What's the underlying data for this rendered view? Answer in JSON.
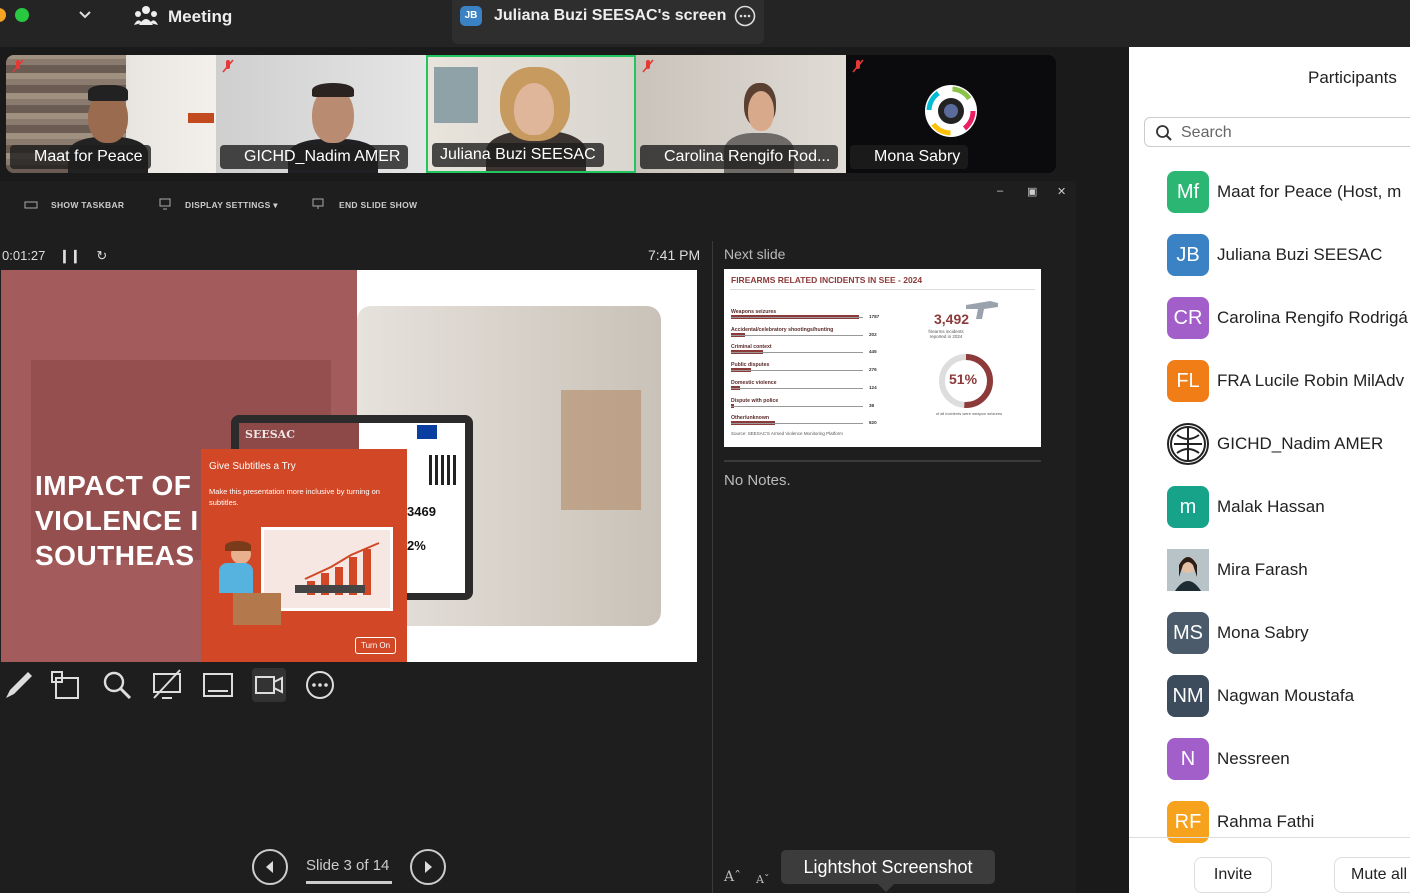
{
  "topbar": {
    "meeting_label": "Meeting",
    "share_badge": "JB",
    "share_title": "Juliana Buzi SEESAC's screen"
  },
  "tiles": [
    {
      "name": "Maat for Peace"
    },
    {
      "name": "GICHD_Nadim AMER"
    },
    {
      "name": "Juliana Buzi SEESAC"
    },
    {
      "name": "Carolina Rengifo Rod..."
    },
    {
      "name": "Mona Sabry"
    }
  ],
  "presenter": {
    "show_taskbar": "SHOW TASKBAR",
    "display_settings": "DISPLAY SETTINGS ▾",
    "end_slide_show": "END SLIDE SHOW",
    "timer": "0:01:27",
    "clock": "7:41 PM",
    "next_slide_label": "Next slide",
    "notes": "No Notes.",
    "slide_counter": "Slide 3 of 14"
  },
  "slide": {
    "title_lines": [
      "IMPACT OF",
      "VIOLENCE I",
      "SOUTHEAS"
    ],
    "laptop_logo": "SEESAC",
    "stat_number": "3469",
    "stat_percent": "2%",
    "popup_title": "Give Subtitles a Try",
    "popup_text": "Make this presentation more inclusive by turning on subtitles.",
    "popup_button": "Turn On"
  },
  "next_slide": {
    "title": "FIREARMS RELATED INCIDENTS IN SEE - 2024",
    "rows": [
      {
        "label": "Weapons seizures",
        "value": "1787"
      },
      {
        "label": "Accidental/celebratory shootings/hunting",
        "value": "202"
      },
      {
        "label": "Criminal context",
        "value": "445"
      },
      {
        "label": "Public disputes",
        "value": "276"
      },
      {
        "label": "Domestic violence",
        "value": "124"
      },
      {
        "label": "Dispute with police",
        "value": "38"
      },
      {
        "label": "Other/unknown",
        "value": "620"
      }
    ],
    "total": "3,492",
    "total_caption": "firearms incidents reported in 2024",
    "percent": "51%",
    "percent_caption": "of all incidents were weapon seizures",
    "source": "Source: SEESAC'S Armed Violence Monitoring Platform"
  },
  "lightshot": "Lightshot Screenshot",
  "participants": {
    "title": "Participants",
    "search_placeholder": "Search",
    "list": [
      {
        "initials": "Mf",
        "name": "Maat for Peace (Host, m",
        "color": "#2bb673"
      },
      {
        "initials": "JB",
        "name": "Juliana Buzi SEESAC",
        "color": "#3b82c4"
      },
      {
        "initials": "CR",
        "name": "Carolina Rengifo Rodrigá",
        "color": "#a25fc9"
      },
      {
        "initials": "FL",
        "name": "FRA Lucile Robin MilAdv",
        "color": "#f07d16"
      },
      {
        "initials": "",
        "name": "GICHD_Nadim AMER",
        "color": "#ffffff"
      },
      {
        "initials": "m",
        "name": "Malak Hassan",
        "color": "#17a38a"
      },
      {
        "initials": "",
        "name": "Mira Farash",
        "color": "#9aa"
      },
      {
        "initials": "MS",
        "name": "Mona Sabry",
        "color": "#4b5b6b"
      },
      {
        "initials": "NM",
        "name": "Nagwan Moustafa",
        "color": "#3d4c5c"
      },
      {
        "initials": "N",
        "name": "Nessreen",
        "color": "#a25fc9"
      },
      {
        "initials": "RF",
        "name": "Rahma Fathi",
        "color": "#f7a21c"
      }
    ],
    "invite": "Invite",
    "mute_all": "Mute all"
  }
}
